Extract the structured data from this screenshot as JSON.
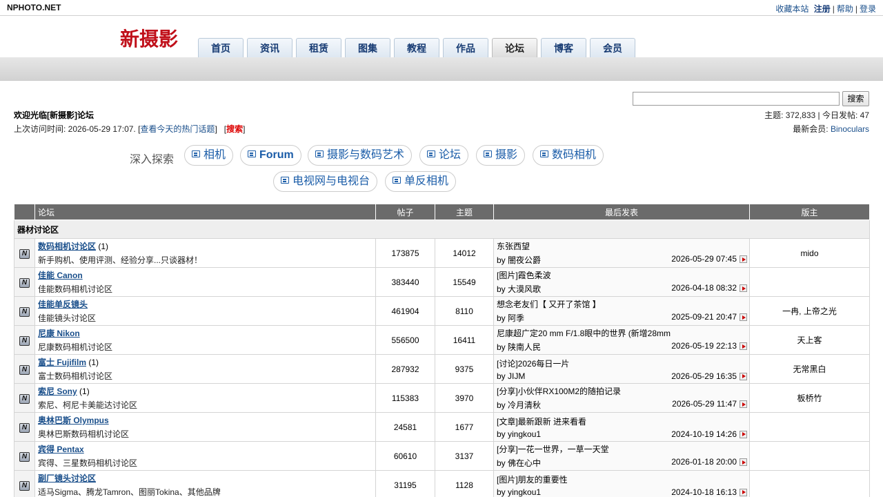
{
  "top": {
    "site_name": "NPHOTO.NET",
    "links": [
      "收藏本站",
      "注册",
      "帮助",
      "登录"
    ]
  },
  "header": {
    "logo": "新摄影",
    "nav": [
      "首页",
      "资讯",
      "租赁",
      "图集",
      "教程",
      "作品",
      "论坛",
      "博客",
      "会员"
    ],
    "active_nav": "论坛"
  },
  "search": {
    "input_value": "",
    "button": "搜索"
  },
  "info": {
    "welcome": "欢迎光临[新摄影]论坛",
    "last_visit_prefix": "上次访问时间: 2026-05-29 17:07. [",
    "hot_link": "查看今天的热门话题",
    "mid": "]   [",
    "search_link": "搜索",
    "suffix": "]",
    "stats": "主题: 372,833 | 今日发帖: 47",
    "newest_label": "最新会员: ",
    "newest_member": "Binoculars"
  },
  "explore": {
    "label": "深入探索",
    "chips": [
      "相机",
      "Forum",
      "摄影与数码艺术",
      "论坛",
      "摄影",
      "数码相机",
      "电视网与电视台",
      "单反相机"
    ]
  },
  "table": {
    "headers": [
      "论坛",
      "帖子",
      "主题",
      "最后发表",
      "版主"
    ],
    "category": "器材讨论区",
    "rows": [
      {
        "name": "数码相机讨论区",
        "count": "(1)",
        "desc": "新手购机、使用评测、经验分享...只谈器材！",
        "posts": "173875",
        "topics": "14012",
        "last_title": "东张西望",
        "last_by": "by 闇夜公爵",
        "last_date": "2026-05-29 07:45",
        "mod": "mido"
      },
      {
        "name": "佳能 Canon",
        "count": "",
        "desc": "佳能数码相机讨论区",
        "posts": "383440",
        "topics": "15549",
        "last_title": "[图片]霞色柔波",
        "last_by": "by 大漠风歌",
        "last_date": "2026-04-18 08:32",
        "mod": ""
      },
      {
        "name": "佳能单反镜头",
        "count": "",
        "desc": "佳能镜头讨论区",
        "posts": "461904",
        "topics": "8110",
        "last_title": "想念老友们【 又开了茶馆 】",
        "last_by": "by 阿季",
        "last_date": "2025-09-21 20:47",
        "mod": "一冉, 上帝之光"
      },
      {
        "name": "尼康 Nikon",
        "count": "",
        "desc": "尼康数码相机讨论区",
        "posts": "556500",
        "topics": "16411",
        "last_title": "尼康超广定20 mm F/1.8眼中的世界 (新增28mm",
        "last_by": "by 陕南人民",
        "last_date": "2026-05-19 22:13",
        "mod": "天上客"
      },
      {
        "name": "富士 Fujifilm",
        "count": "(1)",
        "desc": "富士数码相机讨论区",
        "posts": "287932",
        "topics": "9375",
        "last_title": "[讨论]2026每日一片",
        "last_by": "by JIJM",
        "last_date": "2026-05-29 16:35",
        "mod": "无常黑白"
      },
      {
        "name": "索尼 Sony",
        "count": "(1)",
        "desc": "索尼、柯尼卡美能达讨论区",
        "posts": "115383",
        "topics": "3970",
        "last_title": "[分享]小伙伴RX100M2的随拍记录",
        "last_by": "by 冷月清秋",
        "last_date": "2026-05-29 11:47",
        "mod": "板桥竹"
      },
      {
        "name": "奥林巴斯 Olympus",
        "count": "",
        "desc": "奥林巴斯数码相机讨论区",
        "posts": "24581",
        "topics": "1677",
        "last_title": "[文章]最新跟新 进来看看",
        "last_by": "by yingkou1",
        "last_date": "2024-10-19 14:26",
        "mod": ""
      },
      {
        "name": "宾得 Pentax",
        "count": "",
        "desc": "宾得、三星数码相机讨论区",
        "posts": "60610",
        "topics": "3137",
        "last_title": "[分享]一花一世界，一草一天堂",
        "last_by": "by 佛在心中",
        "last_date": "2026-01-18 20:00",
        "mod": ""
      },
      {
        "name": "副厂镜头讨论区",
        "count": "",
        "desc": "适马Sigma、腾龙Tamron、图丽Tokina、其他品牌",
        "posts": "31195",
        "topics": "1128",
        "last_title": "[图片]朋友的重要性",
        "last_by": "by yingkou1",
        "last_date": "2024-10-18 16:13",
        "mod": ""
      }
    ]
  }
}
